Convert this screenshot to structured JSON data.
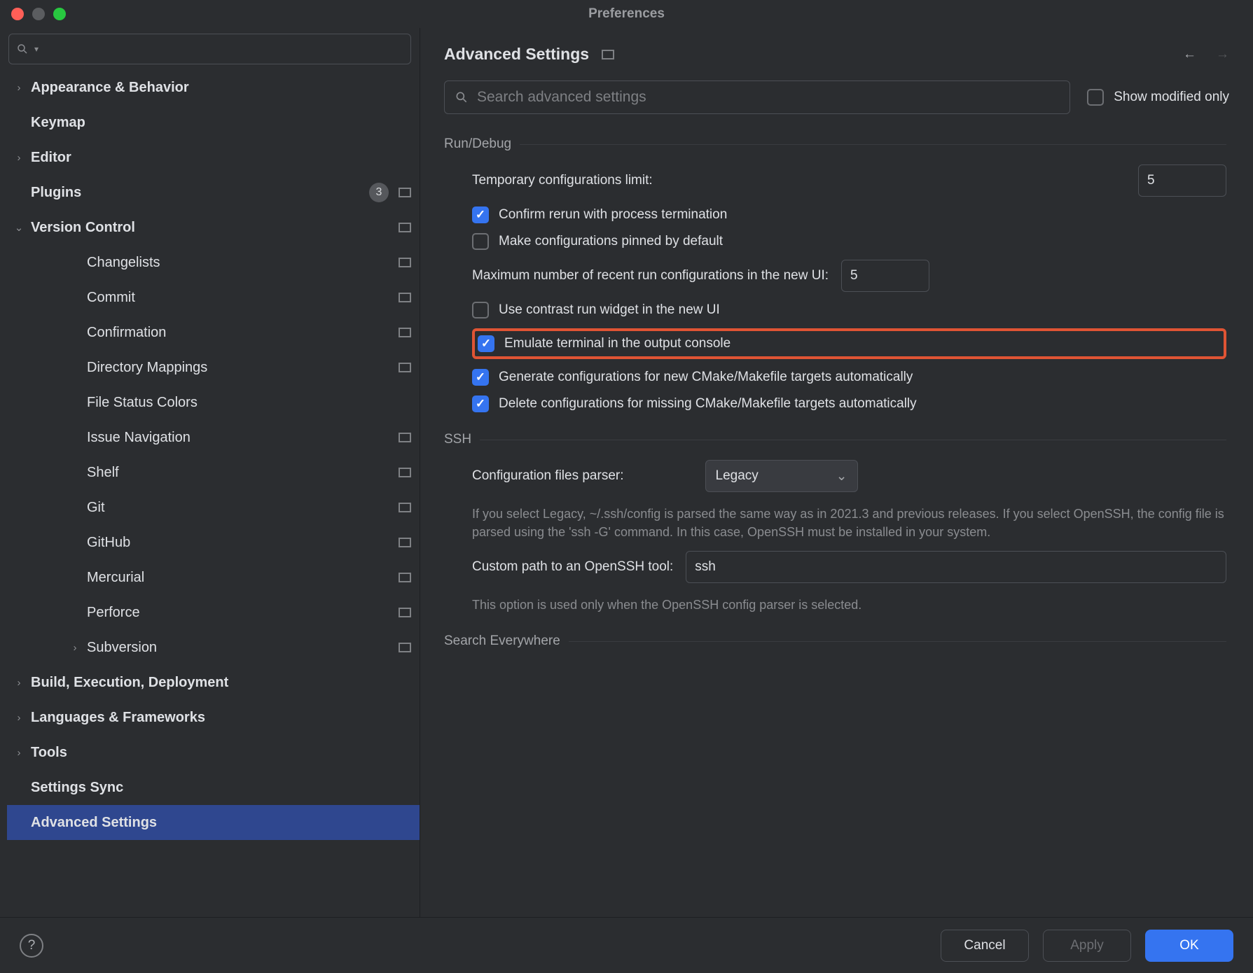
{
  "window": {
    "title": "Preferences"
  },
  "sidebar": {
    "search_placeholder": "",
    "items": [
      {
        "label": "Appearance & Behavior",
        "type": "group",
        "bold": true,
        "arrow": ">"
      },
      {
        "label": "Keymap",
        "type": "item",
        "bold": true
      },
      {
        "label": "Editor",
        "type": "group",
        "bold": true,
        "arrow": ">"
      },
      {
        "label": "Plugins",
        "type": "item",
        "bold": true,
        "badge": "3",
        "cube": true
      },
      {
        "label": "Version Control",
        "type": "group",
        "bold": true,
        "arrow": "v",
        "cube": true
      },
      {
        "label": "Changelists",
        "type": "sub",
        "cube": true
      },
      {
        "label": "Commit",
        "type": "sub",
        "cube": true
      },
      {
        "label": "Confirmation",
        "type": "sub",
        "cube": true
      },
      {
        "label": "Directory Mappings",
        "type": "sub",
        "cube": true
      },
      {
        "label": "File Status Colors",
        "type": "sub"
      },
      {
        "label": "Issue Navigation",
        "type": "sub",
        "cube": true
      },
      {
        "label": "Shelf",
        "type": "sub",
        "cube": true
      },
      {
        "label": "Git",
        "type": "sub",
        "cube": true
      },
      {
        "label": "GitHub",
        "type": "sub",
        "cube": true
      },
      {
        "label": "Mercurial",
        "type": "sub",
        "cube": true
      },
      {
        "label": "Perforce",
        "type": "sub",
        "cube": true
      },
      {
        "label": "Subversion",
        "type": "sub",
        "arrow": ">",
        "cube": true
      },
      {
        "label": "Build, Execution, Deployment",
        "type": "group",
        "bold": true,
        "arrow": ">"
      },
      {
        "label": "Languages & Frameworks",
        "type": "group",
        "bold": true,
        "arrow": ">"
      },
      {
        "label": "Tools",
        "type": "group",
        "bold": true,
        "arrow": ">"
      },
      {
        "label": "Settings Sync",
        "type": "item",
        "bold": true
      },
      {
        "label": "Advanced Settings",
        "type": "item",
        "bold": true,
        "selected": true
      }
    ]
  },
  "content": {
    "title": "Advanced Settings",
    "search_placeholder": "Search advanced settings",
    "show_modified_only": "Show modified only",
    "sections": {
      "run_debug": {
        "title": "Run/Debug",
        "temp_conf_limit_label": "Temporary configurations limit:",
        "temp_conf_limit_value": "5",
        "confirm_rerun": "Confirm rerun with process termination",
        "pinned_default": "Make configurations pinned by default",
        "max_recent_label": "Maximum number of recent run configurations in the new UI:",
        "max_recent_value": "5",
        "contrast_widget": "Use contrast run widget in the new UI",
        "emulate_terminal": "Emulate terminal in the output console",
        "gen_configs": "Generate configurations for new CMake/Makefile targets automatically",
        "del_configs": "Delete configurations for missing CMake/Makefile targets automatically"
      },
      "ssh": {
        "title": "SSH",
        "parser_label": "Configuration files parser:",
        "parser_value": "Legacy",
        "parser_hint": "If you select Legacy, ~/.ssh/config is parsed the same way as in 2021.3 and previous releases. If you select OpenSSH, the config file is parsed using the 'ssh -G' command. In this case, OpenSSH must be installed in your system.",
        "custom_path_label": "Custom path to an OpenSSH tool:",
        "custom_path_value": "ssh",
        "custom_path_hint": "This option is used only when the OpenSSH config parser is selected."
      },
      "search_everywhere": {
        "title": "Search Everywhere"
      }
    }
  },
  "footer": {
    "cancel": "Cancel",
    "apply": "Apply",
    "ok": "OK"
  }
}
